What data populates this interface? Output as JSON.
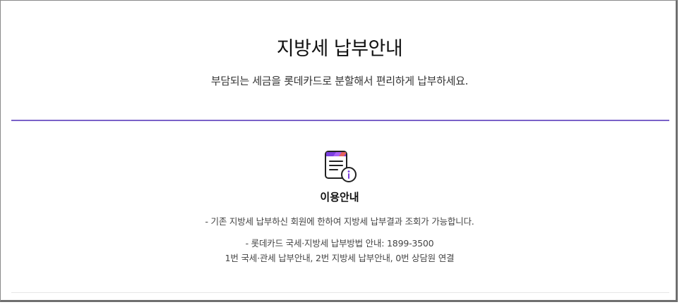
{
  "header": {
    "title": "지방세 납부안내",
    "subtitle": "부담되는 세금을 롯데카드로 분할해서 편리하게 납부하세요."
  },
  "info": {
    "icon": "document-info-icon",
    "heading": "이용안내",
    "notice": "- 기존 지방세 납부하신 회원에 한하여 지방세 납부결과 조회가 가능합니다.",
    "phone_line": "- 롯데카드 국세·지방세 납부방법 안내: 1899-3500",
    "menu_line": "1번 국세·관세 납부안내, 2번 지방세 납부안내, 0번 상담원 연결"
  },
  "colors": {
    "accent": "#7a62c8",
    "icon_top": "#7b3fe0",
    "icon_info": "#7b3fe0"
  }
}
